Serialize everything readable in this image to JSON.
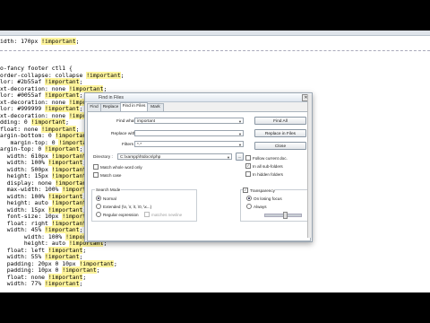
{
  "editor": {
    "lines": [
      {
        "text": "idth: 170px ",
        "kw": "!important",
        "tail": ";"
      },
      {
        "text": "",
        "kw": "",
        "tail": ""
      },
      {
        "text": "",
        "kw": "",
        "tail": ""
      },
      {
        "text": "",
        "kw": "",
        "tail": ""
      },
      {
        "text": "o-fancy footer ctl1 {",
        "kw": "",
        "tail": ""
      },
      {
        "text": "order-collapse: collapse ",
        "kw": "!important",
        "tail": ";"
      },
      {
        "text": "lor: #2b55af ",
        "kw": "!important",
        "tail": ";"
      },
      {
        "text": "xt-decoration: none ",
        "kw": "!important",
        "tail": ";"
      },
      {
        "text": "lor: #0055af ",
        "kw": "!important",
        "tail": ";"
      },
      {
        "text": "xt-decoration: none ",
        "kw": "!important",
        "tail": ";"
      },
      {
        "text": "lor: #999999 ",
        "kw": "!important",
        "tail": ";"
      },
      {
        "text": "xt-decoration: none ",
        "kw": "!important",
        "tail": ";"
      },
      {
        "text": "dding: 0 ",
        "kw": "!important",
        "tail": ";"
      },
      {
        "text": "float: none ",
        "kw": "!important",
        "tail": ";"
      },
      {
        "text": "argin-bottom: 0 ",
        "kw": "!important",
        "tail": ";"
      },
      {
        "text": "   margin-top: 0 ",
        "kw": "!important",
        "tail": ";"
      },
      {
        "text": "argin-top: 0 ",
        "kw": "!important",
        "tail": ";"
      },
      {
        "text": "  width: 610px ",
        "kw": "!important",
        "tail": ";"
      },
      {
        "text": "  width: 100% ",
        "kw": "!important",
        "tail": ";"
      },
      {
        "text": "  width: 500px ",
        "kw": "!important",
        "tail": ";"
      },
      {
        "text": "  height: 15px ",
        "kw": "!important",
        "tail": ";"
      },
      {
        "text": "  display: none ",
        "kw": "!important",
        "tail": ";"
      },
      {
        "text": "  max-width: 100% ",
        "kw": "!important",
        "tail": ";"
      },
      {
        "text": "  width: 100% ",
        "kw": "!important",
        "tail": ";"
      },
      {
        "text": "  height: auto ",
        "kw": "!important",
        "tail": ";"
      },
      {
        "text": "  width: 15px ",
        "kw": "!important",
        "tail": ";"
      },
      {
        "text": "  font-size: 10px ",
        "kw": "!important",
        "tail": ";"
      },
      {
        "text": "  float: right ",
        "kw": "!important",
        "tail": ";"
      },
      {
        "text": "  width: 45% ",
        "kw": "!important",
        "tail": ";"
      },
      {
        "text": "       width: 100% ",
        "kw": "!important",
        "tail": ";"
      },
      {
        "text": "       height: auto ",
        "kw": "!important",
        "tail": ";"
      },
      {
        "text": "  float: left ",
        "kw": "!important",
        "tail": ";"
      },
      {
        "text": "  width: 55% ",
        "kw": "!important",
        "tail": ";"
      },
      {
        "text": "  padding: 20px 0 10px ",
        "kw": "!important",
        "tail": ";"
      },
      {
        "text": "  padding: 10px 0 ",
        "kw": "!important",
        "tail": ";"
      },
      {
        "text": "  float: none ",
        "kw": "!important",
        "tail": ";"
      },
      {
        "text": "  width: 77% ",
        "kw": "!important",
        "tail": ";"
      }
    ]
  },
  "dialog": {
    "title": "Find in Files",
    "close_glyph": "✕",
    "tabs": [
      "Find",
      "Replace",
      "Find in Files",
      "Mark"
    ],
    "active_tab": "Find in Files",
    "find_what_label": "Find what :",
    "find_what_value": "important",
    "replace_with_label": "Replace with :",
    "replace_with_value": "",
    "filters_label": "Filters :",
    "filters_value": "*.*",
    "directory_label": "Directory :",
    "directory_value": "C:\\xampp\\htdocs\\php",
    "browse_label": "...",
    "buttons": {
      "find_all": "Find All",
      "replace_in_files": "Replace in Files",
      "close": "Close"
    },
    "checks": {
      "follow_current_doc": "Follow current doc.",
      "in_all_subfolders": "In all sub-folders",
      "in_hidden_folders": "In hidden folders",
      "match_whole_word": "Match whole word only",
      "match_case": "Match case"
    },
    "search_mode": {
      "title": "Search Mode",
      "normal": "Normal",
      "extended": "Extended (\\n, \\r, \\t, \\0, \\x...)",
      "regex": "Regular expression",
      "matches_newline": "matches newline"
    },
    "transparency": {
      "title": "Transparency",
      "on_losing_focus": "On losing focus",
      "always": "Always",
      "level": 0.55
    }
  }
}
